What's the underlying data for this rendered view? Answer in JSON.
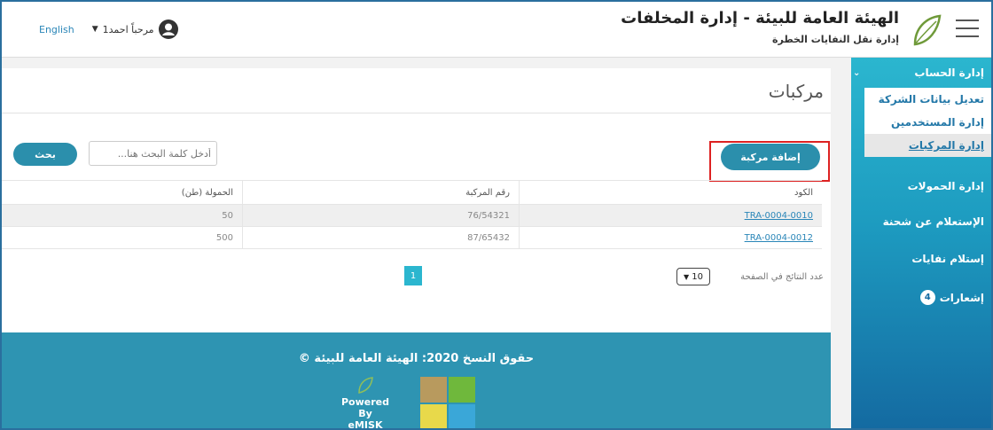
{
  "header": {
    "org_title": "الهيئة العامة للبيئة - إدارة المخلفات",
    "org_subtitle": "إدارة نقل النفايات الخطرة",
    "language_link": "English",
    "greeting": "مرحباً احمد1"
  },
  "sidebar": {
    "section_title": "إدارة الحساب",
    "sub_items": [
      "تعديل بيانات الشركة",
      "إدارة المستخدمين",
      "إدارة المركبات"
    ],
    "active_item": "إدارة المركبات",
    "items": [
      "إدارة الحمولات",
      "الإستعلام عن شحنة",
      "إستلام نفايات"
    ],
    "notifications_label": "إشعارات",
    "notifications_count": "4"
  },
  "main": {
    "page_title": "مركبات",
    "add_button": "إضافة مركبة",
    "search_placeholder": "أدخل كلمة البحث هنا...",
    "search_button": "بحث",
    "table": {
      "headers": [
        "الكود",
        "رقم المركبة",
        "الحمولة (طن)"
      ],
      "rows": [
        [
          "TRA-0004-0010",
          "76/54321",
          "50"
        ],
        [
          "TRA-0004-0012",
          "87/65432",
          "500"
        ]
      ]
    },
    "pagination": {
      "current_page": "1",
      "per_page_label": "عدد النتائج في الصفحة",
      "per_page_value": "10"
    }
  },
  "footer": {
    "copyright": "حقوق النسخ 2020: الهيئة العامة للبيئة ©",
    "powered_by": "Powered By",
    "brand": "eMISK"
  },
  "colors": {
    "accent": "#2b8fac",
    "sidebar_top": "#2bb6cf",
    "sidebar_bottom": "#146aa1",
    "highlight": "#dd2222"
  }
}
